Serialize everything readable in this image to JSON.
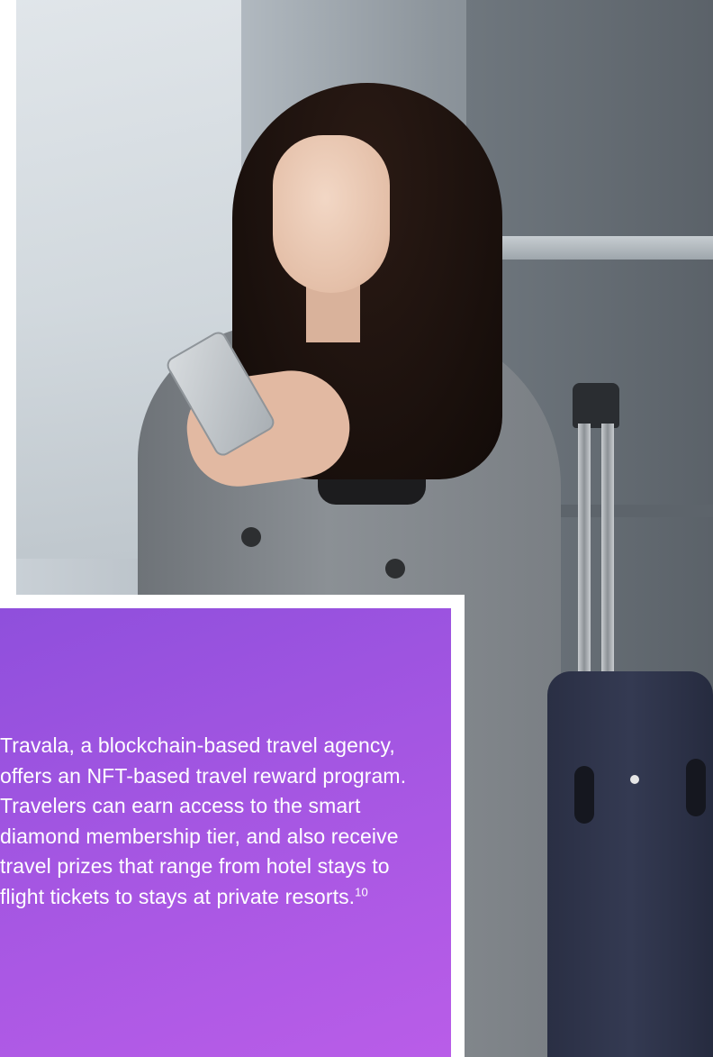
{
  "photo": {
    "subject": "woman-with-phone-and-suitcase"
  },
  "panel": {
    "text": "Travala, a blockchain-based travel agency, offers an NFT-based travel reward program. Travelers can earn access to the smart diamond membership tier, and also receive travel prizes that range from hotel stays to flight tickets to stays at private resorts.",
    "footnote": "10",
    "background_color": "#a456e2",
    "text_color": "#ffffff"
  }
}
